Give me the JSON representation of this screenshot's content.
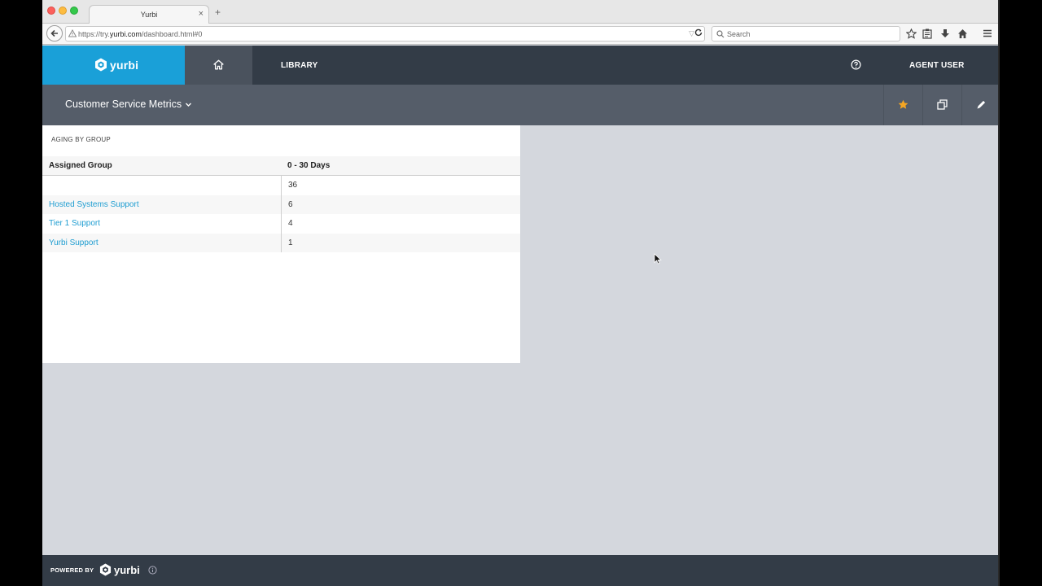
{
  "browser": {
    "tab_title": "Yurbi",
    "tab_close": "×",
    "new_tab": "+",
    "url_prefix": "https://try.",
    "url_domain": "yurbi.com",
    "url_path": "/dashboard.html#0",
    "search_placeholder": "Search"
  },
  "header": {
    "logo_text": "yurbi",
    "library_label": "LIBRARY",
    "user_label": "AGENT USER"
  },
  "dashboard": {
    "title": "Customer Service Metrics"
  },
  "widget": {
    "title": "AGING BY GROUP",
    "columns": [
      "Assigned Group",
      "0 - 30 Days"
    ],
    "rows": [
      {
        "group": "",
        "value": "36"
      },
      {
        "group": "Hosted Systems Support",
        "value": "6"
      },
      {
        "group": "Tier 1 Support",
        "value": "4"
      },
      {
        "group": "Yurbi Support",
        "value": "1"
      }
    ]
  },
  "footer": {
    "powered_by": "POWERED BY",
    "logo_text": "yurbi"
  },
  "colors": {
    "brand_blue": "#1aa0d8",
    "header_dark": "#333c47",
    "subheader": "#555d69",
    "link": "#1e9dd1",
    "favorite_star": "#f5a623"
  }
}
